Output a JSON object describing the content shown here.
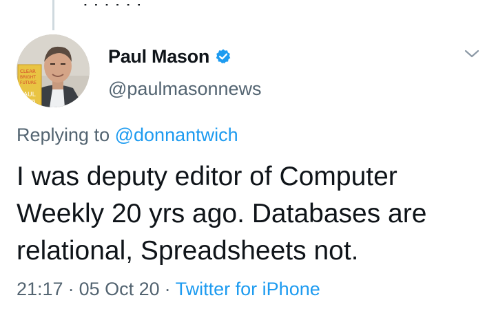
{
  "tweet": {
    "author": {
      "display_name": "Paul Mason",
      "handle": "@paulmasonnews",
      "verified": true,
      "avatar_book_text": [
        "CLEAR",
        "BRIGHT",
        "FUTURE",
        "PAUL",
        "MASON"
      ]
    },
    "reply": {
      "prefix": "Replying to",
      "to_handle": "@donnantwich"
    },
    "text_lines": [
      "I was deputy editor of Computer",
      "Weekly 20 yrs ago. Databases are",
      "relational, Spreadsheets not."
    ],
    "time": "21:17",
    "date": "05 Oct 20",
    "separator": "·",
    "source": "Twitter for iPhone"
  },
  "colors": {
    "text_primary": "#0f1419",
    "text_secondary": "#536471",
    "link": "#1d9bf0",
    "verified_badge": "#1d9bf0",
    "thread_line": "#cfd9de"
  },
  "icons": {
    "verified": "verified-badge-icon",
    "more": "chevron-down-icon"
  }
}
